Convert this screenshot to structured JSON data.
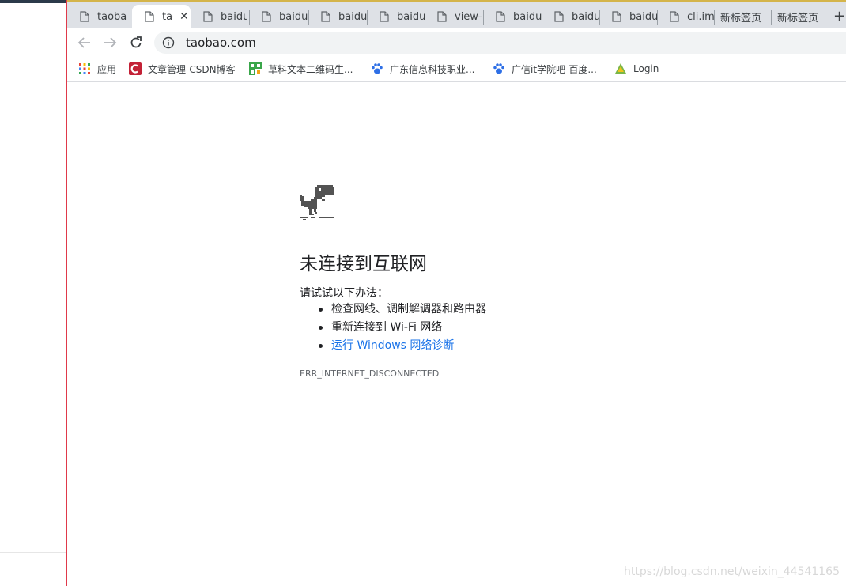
{
  "tabs": [
    {
      "title": "taoba",
      "active": false
    },
    {
      "title": "tao",
      "active": true,
      "close": "✕"
    },
    {
      "title": "baidu",
      "active": false
    },
    {
      "title": "baidu",
      "active": false
    },
    {
      "title": "baidu",
      "active": false
    },
    {
      "title": "baidu",
      "active": false
    },
    {
      "title": "view-",
      "active": false
    },
    {
      "title": "baidu",
      "active": false
    },
    {
      "title": "baidu",
      "active": false
    },
    {
      "title": "baidu",
      "active": false
    },
    {
      "title": "cli.im",
      "active": false
    },
    {
      "title": "新标签页",
      "active": false
    },
    {
      "title": "新标签页",
      "active": false
    }
  ],
  "new_tab": "+",
  "toolbar": {
    "url": "taobao.com",
    "back_icon": "arrow-left-icon",
    "forward_icon": "arrow-right-icon",
    "reload_icon": "reload-icon"
  },
  "bookmarks": [
    {
      "label": "应用",
      "icon": "apps-grid-icon"
    },
    {
      "label": "文章管理-CSDN博客",
      "icon": "csdn-icon"
    },
    {
      "label": "草料文本二维码生...",
      "icon": "qrcode-icon"
    },
    {
      "label": "广东信息科技职业...",
      "icon": "baidu-paw-icon"
    },
    {
      "label": "广信it学院吧-百度...",
      "icon": "baidu-paw-icon"
    },
    {
      "label": "Login",
      "icon": "login-logo-icon"
    }
  ],
  "error": {
    "title": "未连接到互联网",
    "intro": "请试试以下办法：",
    "suggestions": [
      "检查网线、调制解调器和路由器",
      "重新连接到 Wi-Fi 网络",
      "运行 Windows 网络诊断"
    ],
    "code": "ERR_INTERNET_DISCONNECTED"
  },
  "watermark": "https://blog.csdn.net/weixin_44541165",
  "colors": {
    "tabstrip": "#dee1e6",
    "link": "#1a73e8",
    "dino": "#535353"
  }
}
